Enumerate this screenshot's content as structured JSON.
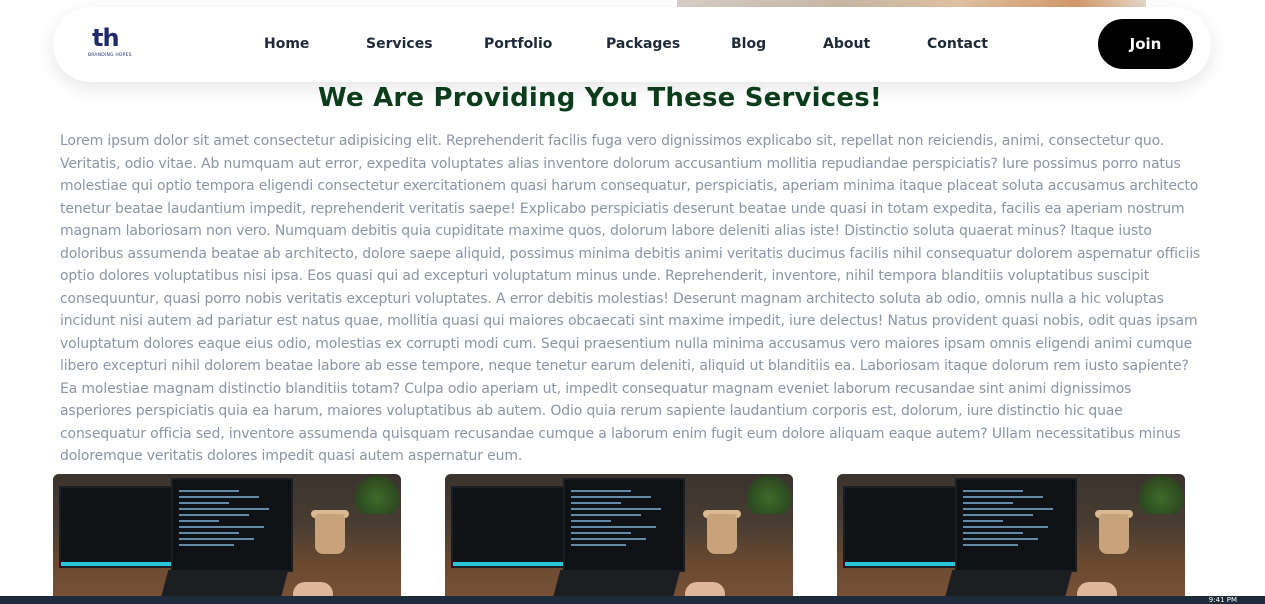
{
  "brand": {
    "logo_mark": "th",
    "logo_sub": "BRANDING HOPES",
    "accent": "#1f2a6b"
  },
  "nav": {
    "items": [
      {
        "label": "Home"
      },
      {
        "label": "Services"
      },
      {
        "label": "Portfolio"
      },
      {
        "label": "Packages"
      },
      {
        "label": "Blog"
      },
      {
        "label": "About"
      },
      {
        "label": "Contact"
      }
    ],
    "cta_label": "Join"
  },
  "section": {
    "heading": "We Are Providing You These Services!",
    "heading_color": "#0b3d1c",
    "paragraph": "Lorem ipsum dolor sit amet consectetur adipisicing elit. Reprehenderit facilis fuga vero dignissimos explicabo sit, repellat non reiciendis, animi, consectetur quo. Veritatis, odio vitae. Ab numquam aut error, expedita voluptates alias inventore dolorum accusantium mollitia repudiandae perspiciatis? Iure possimus porro natus molestiae qui optio tempora eligendi consectetur exercitationem quasi harum consequatur, perspiciatis, aperiam minima itaque placeat soluta accusamus architecto tenetur beatae laudantium impedit, reprehenderit veritatis saepe! Explicabo perspiciatis deserunt beatae unde quasi in totam expedita, facilis ea aperiam nostrum magnam laboriosam non vero. Numquam debitis quia cupiditate maxime quos, dolorum labore deleniti alias iste! Distinctio soluta quaerat minus? Itaque iusto doloribus assumenda beatae ab architecto, dolore saepe aliquid, possimus minima debitis animi veritatis ducimus facilis nihil consequatur dolorem aspernatur officiis optio dolores voluptatibus nisi ipsa. Eos quasi qui ad excepturi voluptatum minus unde. Reprehenderit, inventore, nihil tempora blanditiis voluptatibus suscipit consequuntur, quasi porro nobis veritatis excepturi voluptates. A error debitis molestias! Deserunt magnam architecto soluta ab odio, omnis nulla a hic voluptas incidunt nisi autem ad pariatur est natus quae, mollitia quasi qui maiores obcaecati sint maxime impedit, iure delectus! Natus provident quasi nobis, odit quas ipsam voluptatum dolores eaque eius odio, molestias ex corrupti modi cum. Sequi praesentium nulla minima accusamus vero maiores ipsam omnis eligendi animi cumque libero excepturi nihil dolorem beatae labore ab esse tempore, neque tenetur earum deleniti, aliquid ut blanditiis ea. Laboriosam itaque dolorum rem iusto sapiente? Ea molestiae magnam distinctio blanditiis totam? Culpa odio aperiam ut, impedit consequatur magnam eveniet laborum recusandae sint animi dignissimos asperiores perspiciatis quia ea harum, maiores voluptatibus ab autem. Odio quia rerum sapiente laudantium corporis est, dolorum, iure distinctio hic quae consequatur officia sed, inventore assumenda quisquam recusandae cumque a laborum enim fugit eum dolore aliquam eaque autem? Ullam necessitatibus minus doloremque veritatis dolores impedit quasi autem aspernatur eum."
  },
  "cards": [
    {
      "image": "desk-coding-setup-photo"
    },
    {
      "image": "desk-coding-setup-photo"
    },
    {
      "image": "desk-coding-setup-photo"
    }
  ],
  "taskbar": {
    "clock": "9:41 PM"
  }
}
